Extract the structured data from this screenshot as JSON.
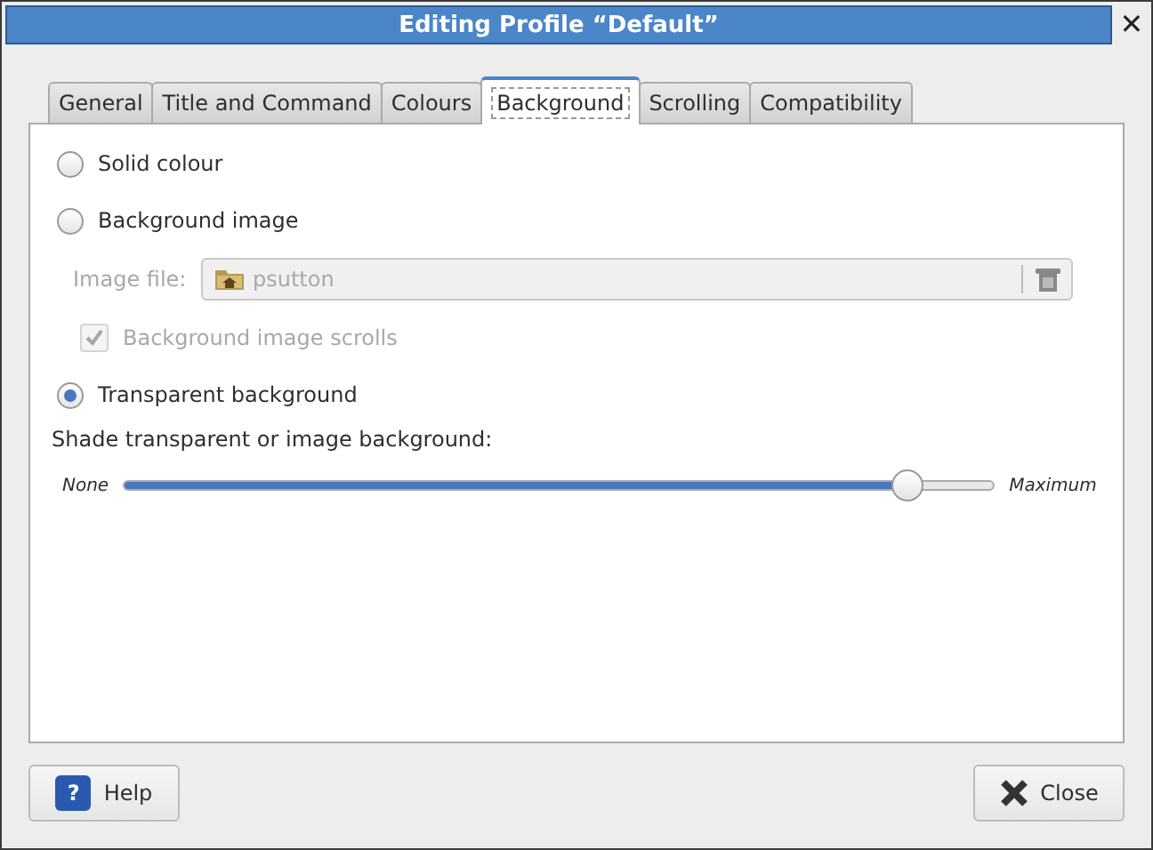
{
  "window": {
    "title": "Editing Profile “Default”",
    "close_glyph": "✕"
  },
  "tabs": [
    {
      "label": "General",
      "selected": false
    },
    {
      "label": "Title and Command",
      "selected": false
    },
    {
      "label": "Colours",
      "selected": false
    },
    {
      "label": "Background",
      "selected": true
    },
    {
      "label": "Scrolling",
      "selected": false
    },
    {
      "label": "Compatibility",
      "selected": false
    }
  ],
  "options": [
    {
      "kind": "radio",
      "label": "Solid colour",
      "selected": false,
      "disabled": false
    },
    {
      "kind": "radio",
      "label": "Background image",
      "selected": false,
      "disabled": false
    },
    {
      "kind": "file",
      "label": "Image file:",
      "value": "psutton",
      "disabled": true
    },
    {
      "kind": "checkbox",
      "label": "Background image scrolls",
      "checked": true,
      "disabled": true
    },
    {
      "kind": "radio",
      "label": "Transparent background",
      "selected": true,
      "disabled": false
    }
  ],
  "shade": {
    "label": "Shade transparent or image background:",
    "min_label": "None",
    "max_label": "Maximum",
    "level": 0.9
  },
  "buttons": [
    {
      "kind": "help",
      "label": "Help",
      "glyph": "?"
    },
    {
      "kind": "close",
      "label": "Close"
    }
  ]
}
